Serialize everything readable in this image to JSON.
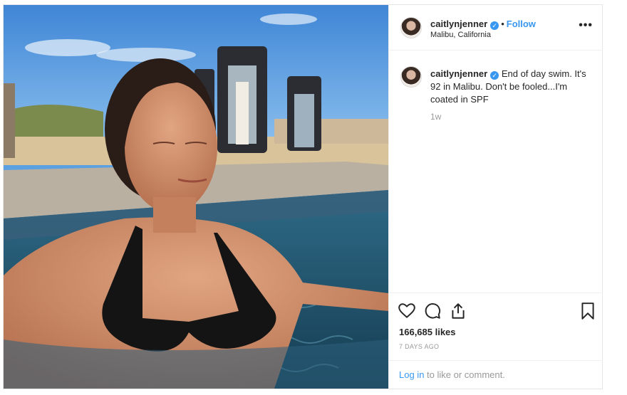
{
  "post": {
    "username": "caitlynjenner",
    "follow_label": "Follow",
    "location": "Malibu, California",
    "more_label": "•••",
    "caption": {
      "username": "caitlynjenner",
      "text": "End of day swim. It's 92 in Malibu. Don't be fooled...I'm coated in SPF",
      "time": "1w"
    },
    "likes": "166,685 likes",
    "posted": "7 DAYS AGO",
    "login": {
      "link": "Log in",
      "rest": " to like or comment."
    },
    "icons": [
      "heart-icon",
      "comment-bubble-icon",
      "share-icon",
      "bookmark-icon",
      "verified-badge-icon",
      "more-options-icon"
    ],
    "colors": {
      "accent": "#3897f0",
      "muted": "#999999",
      "border": "#efefef"
    }
  }
}
